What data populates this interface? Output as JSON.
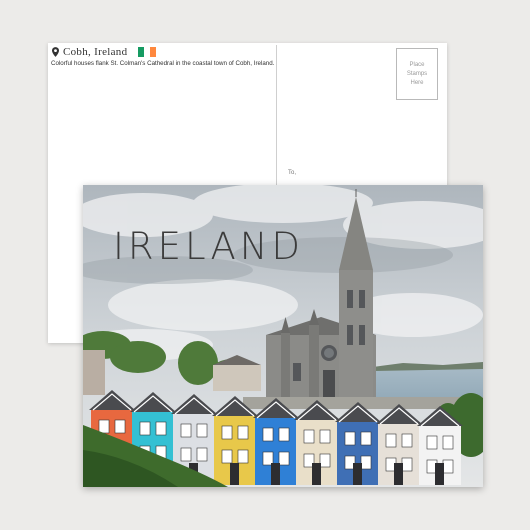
{
  "back": {
    "location": "Cobh, Ireland",
    "caption": "Colorful houses flank St. Colman's Cathedral in the coastal town of Cobh, Ireland.",
    "stamp_text": "Place\nStamps\nHere",
    "to_label": "To,",
    "flag_colors": [
      "#169b62",
      "#ffffff",
      "#ff883e"
    ]
  },
  "front": {
    "title": "IRELAND",
    "house_colors": [
      "#e8683f",
      "#34c0d3",
      "#dcdfe4",
      "#e8c84a",
      "#2f80d6",
      "#e9dfc9",
      "#3f6fb5",
      "#e6e0d8",
      "#f3f3f3"
    ]
  }
}
